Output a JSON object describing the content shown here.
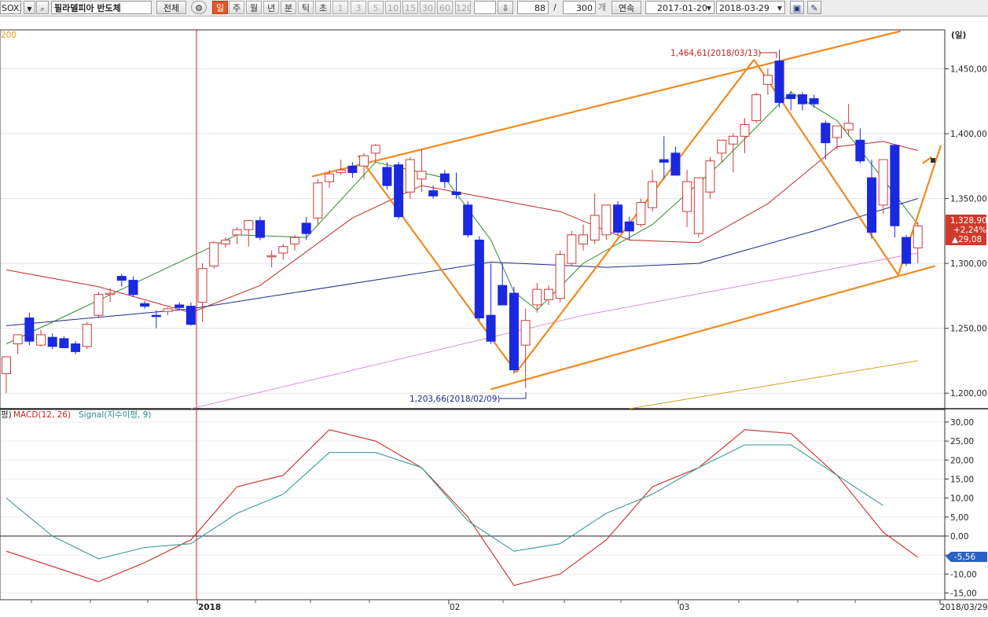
{
  "toolbar": {
    "symbol_code": "SOXX",
    "symbol_name": "필라델피아 반도체",
    "all_button": "전체",
    "periods": [
      {
        "label": "일",
        "active": true,
        "dim": false
      },
      {
        "label": "주",
        "active": false,
        "dim": false
      },
      {
        "label": "월",
        "active": false,
        "dim": false
      },
      {
        "label": "년",
        "active": false,
        "dim": false
      },
      {
        "label": "분",
        "active": false,
        "dim": false
      },
      {
        "label": "틱",
        "active": false,
        "dim": false
      },
      {
        "label": "초",
        "active": false,
        "dim": false
      },
      {
        "label": "1",
        "active": false,
        "dim": true
      },
      {
        "label": "3",
        "active": false,
        "dim": true
      },
      {
        "label": "5",
        "active": false,
        "dim": true
      },
      {
        "label": "10",
        "active": false,
        "dim": true
      },
      {
        "label": "15",
        "active": false,
        "dim": true
      },
      {
        "label": "30",
        "active": false,
        "dim": true
      },
      {
        "label": "60",
        "active": false,
        "dim": true
      },
      {
        "label": "120",
        "active": false,
        "dim": true
      }
    ],
    "count_value": "88",
    "separator": "/",
    "total_value": "300",
    "count_unit": "개",
    "continuous_button": "연속",
    "start_date": "2017-01-20",
    "end_date": "2018-03-29"
  },
  "header": {
    "period_unit": "(일)",
    "ma_label": "200"
  },
  "macd_header": {
    "prefix": "평)",
    "macd_label": "MACD(12, 26)",
    "signal_label": "Signal(지수이평, 9)"
  },
  "colors": {
    "up": "#d03a3a",
    "down": "#1a28e0",
    "ma5": "#2e8b2e",
    "ma20": "#c0282a",
    "ma60": "#1e2a8a",
    "ma120": "#d890d8",
    "ma200": "#d4a020",
    "trend": "#f08a20",
    "macd": "#d02828",
    "signal": "#3a9a9a",
    "cursor": "#cc2020"
  },
  "chart_data": [
    {
      "type": "candlestick",
      "title": "필라델피아 반도체",
      "x_labels": [
        "2018",
        "02",
        "03",
        "2018/03/29"
      ],
      "ylim": [
        1188,
        1480
      ],
      "y_ticks": [
        "1,200,00",
        "1,250,00",
        "1,300,00",
        "1,350,00",
        "1,400,00",
        "1,450,00"
      ],
      "candles": [
        {
          "o": 1215,
          "h": 1225,
          "l": 1200,
          "c": 1228
        },
        {
          "o": 1238,
          "h": 1245,
          "l": 1230,
          "c": 1245
        },
        {
          "o": 1258,
          "h": 1262,
          "l": 1237,
          "c": 1240
        },
        {
          "o": 1237,
          "h": 1249,
          "l": 1236,
          "c": 1245
        },
        {
          "o": 1243,
          "h": 1246,
          "l": 1234,
          "c": 1236
        },
        {
          "o": 1242,
          "h": 1244,
          "l": 1235,
          "c": 1235
        },
        {
          "o": 1238,
          "h": 1240,
          "l": 1230,
          "c": 1232
        },
        {
          "o": 1236,
          "h": 1255,
          "l": 1234,
          "c": 1253
        },
        {
          "o": 1260,
          "h": 1278,
          "l": 1258,
          "c": 1276
        },
        {
          "o": 1276,
          "h": 1281,
          "l": 1270,
          "c": 1277
        },
        {
          "o": 1290,
          "h": 1292,
          "l": 1282,
          "c": 1287
        },
        {
          "o": 1287,
          "h": 1290,
          "l": 1274,
          "c": 1276
        },
        {
          "o": 1269,
          "h": 1271,
          "l": 1265,
          "c": 1267
        },
        {
          "o": 1260,
          "h": 1264,
          "l": 1250,
          "c": 1259
        },
        {
          "o": 1263,
          "h": 1266,
          "l": 1260,
          "c": 1265
        },
        {
          "o": 1268,
          "h": 1270,
          "l": 1264,
          "c": 1266
        },
        {
          "o": 1267,
          "h": 1270,
          "l": 1252,
          "c": 1253
        },
        {
          "o": 1270,
          "h": 1300,
          "l": 1255,
          "c": 1296
        },
        {
          "o": 1298,
          "h": 1317,
          "l": 1296,
          "c": 1316
        },
        {
          "o": 1315,
          "h": 1320,
          "l": 1312,
          "c": 1318
        },
        {
          "o": 1322,
          "h": 1328,
          "l": 1315,
          "c": 1326
        },
        {
          "o": 1326,
          "h": 1330,
          "l": 1313,
          "c": 1333
        },
        {
          "o": 1333,
          "h": 1336,
          "l": 1318,
          "c": 1320
        },
        {
          "o": 1306,
          "h": 1310,
          "l": 1297,
          "c": 1306
        },
        {
          "o": 1308,
          "h": 1315,
          "l": 1303,
          "c": 1313
        },
        {
          "o": 1315,
          "h": 1322,
          "l": 1310,
          "c": 1320
        },
        {
          "o": 1331,
          "h": 1336,
          "l": 1318,
          "c": 1323
        },
        {
          "o": 1335,
          "h": 1365,
          "l": 1330,
          "c": 1362
        },
        {
          "o": 1363,
          "h": 1372,
          "l": 1358,
          "c": 1369
        },
        {
          "o": 1370,
          "h": 1380,
          "l": 1368,
          "c": 1372
        },
        {
          "o": 1375,
          "h": 1378,
          "l": 1366,
          "c": 1370
        },
        {
          "o": 1375,
          "h": 1385,
          "l": 1365,
          "c": 1383
        },
        {
          "o": 1385,
          "h": 1392,
          "l": 1378,
          "c": 1391
        },
        {
          "o": 1374,
          "h": 1378,
          "l": 1357,
          "c": 1360
        },
        {
          "o": 1376,
          "h": 1378,
          "l": 1334,
          "c": 1336
        },
        {
          "o": 1355,
          "h": 1382,
          "l": 1350,
          "c": 1380
        },
        {
          "o": 1365,
          "h": 1388,
          "l": 1355,
          "c": 1371
        },
        {
          "o": 1356,
          "h": 1360,
          "l": 1350,
          "c": 1352
        },
        {
          "o": 1369,
          "h": 1372,
          "l": 1358,
          "c": 1363
        },
        {
          "o": 1355,
          "h": 1370,
          "l": 1350,
          "c": 1353
        },
        {
          "o": 1345,
          "h": 1348,
          "l": 1320,
          "c": 1322
        },
        {
          "o": 1318,
          "h": 1321,
          "l": 1256,
          "c": 1258
        },
        {
          "o": 1260,
          "h": 1300,
          "l": 1238,
          "c": 1240
        },
        {
          "o": 1283,
          "h": 1300,
          "l": 1270,
          "c": 1268
        },
        {
          "o": 1277,
          "h": 1282,
          "l": 1215,
          "c": 1218
        },
        {
          "o": 1237,
          "h": 1265,
          "l": 1204,
          "c": 1256
        },
        {
          "o": 1268,
          "h": 1285,
          "l": 1262,
          "c": 1280
        },
        {
          "o": 1272,
          "h": 1283,
          "l": 1268,
          "c": 1280
        },
        {
          "o": 1273,
          "h": 1310,
          "l": 1270,
          "c": 1307
        },
        {
          "o": 1300,
          "h": 1325,
          "l": 1298,
          "c": 1322
        },
        {
          "o": 1315,
          "h": 1330,
          "l": 1310,
          "c": 1322
        },
        {
          "o": 1318,
          "h": 1354,
          "l": 1315,
          "c": 1337
        },
        {
          "o": 1322,
          "h": 1345,
          "l": 1318,
          "c": 1345
        },
        {
          "o": 1345,
          "h": 1348,
          "l": 1322,
          "c": 1324
        },
        {
          "o": 1332,
          "h": 1336,
          "l": 1318,
          "c": 1325
        },
        {
          "o": 1330,
          "h": 1350,
          "l": 1328,
          "c": 1347
        },
        {
          "o": 1343,
          "h": 1372,
          "l": 1340,
          "c": 1363
        },
        {
          "o": 1380,
          "h": 1398,
          "l": 1365,
          "c": 1378
        },
        {
          "o": 1385,
          "h": 1390,
          "l": 1368,
          "c": 1368
        },
        {
          "o": 1340,
          "h": 1372,
          "l": 1328,
          "c": 1363
        },
        {
          "o": 1323,
          "h": 1355,
          "l": 1320,
          "c": 1366
        },
        {
          "o": 1355,
          "h": 1382,
          "l": 1350,
          "c": 1379
        },
        {
          "o": 1385,
          "h": 1393,
          "l": 1378,
          "c": 1395
        },
        {
          "o": 1392,
          "h": 1400,
          "l": 1370,
          "c": 1398
        },
        {
          "o": 1398,
          "h": 1412,
          "l": 1385,
          "c": 1407
        },
        {
          "o": 1410,
          "h": 1432,
          "l": 1408,
          "c": 1430
        },
        {
          "o": 1438,
          "h": 1450,
          "l": 1430,
          "c": 1445
        },
        {
          "o": 1456,
          "h": 1464.61,
          "l": 1420,
          "c": 1424
        },
        {
          "o": 1430,
          "h": 1433,
          "l": 1418,
          "c": 1427
        },
        {
          "o": 1430,
          "h": 1432,
          "l": 1418,
          "c": 1423
        },
        {
          "o": 1427,
          "h": 1430,
          "l": 1420,
          "c": 1423
        },
        {
          "o": 1408,
          "h": 1410,
          "l": 1380,
          "c": 1393
        },
        {
          "o": 1397,
          "h": 1405,
          "l": 1388,
          "c": 1406
        },
        {
          "o": 1403,
          "h": 1423,
          "l": 1398,
          "c": 1408
        },
        {
          "o": 1395,
          "h": 1404,
          "l": 1377,
          "c": 1379
        },
        {
          "o": 1366,
          "h": 1380,
          "l": 1319,
          "c": 1324
        },
        {
          "o": 1345,
          "h": 1380,
          "l": 1338,
          "c": 1380
        },
        {
          "o": 1391,
          "h": 1392,
          "l": 1320,
          "c": 1329
        },
        {
          "o": 1320,
          "h": 1322,
          "l": 1298,
          "c": 1300
        },
        {
          "o": 1312,
          "h": 1332,
          "l": 1300,
          "c": 1328.9
        }
      ],
      "moving_averages": [
        {
          "name": "MA5",
          "points": [
            [
              0,
              1238
            ],
            [
              10,
              1280
            ],
            [
              20,
              1322
            ],
            [
              26,
              1320
            ],
            [
              32,
              1378
            ],
            [
              38,
              1366
            ],
            [
              42,
              1318
            ],
            [
              44,
              1278
            ],
            [
              46,
              1264
            ],
            [
              50,
              1300
            ],
            [
              56,
              1330
            ],
            [
              62,
              1378
            ],
            [
              68,
              1432
            ],
            [
              72,
              1410
            ],
            [
              76,
              1365
            ],
            [
              79,
              1330
            ]
          ]
        },
        {
          "name": "MA20",
          "points": [
            [
              0,
              1295
            ],
            [
              8,
              1282
            ],
            [
              16,
              1262
            ],
            [
              22,
              1283
            ],
            [
              30,
              1335
            ],
            [
              36,
              1360
            ],
            [
              42,
              1350
            ],
            [
              48,
              1340
            ],
            [
              54,
              1318
            ],
            [
              60,
              1316
            ],
            [
              66,
              1346
            ],
            [
              72,
              1390
            ],
            [
              76,
              1394
            ],
            [
              79,
              1387
            ]
          ]
        },
        {
          "name": "MA60",
          "points": [
            [
              0,
              1252
            ],
            [
              16,
              1265
            ],
            [
              34,
              1290
            ],
            [
              42,
              1301
            ],
            [
              52,
              1297
            ],
            [
              60,
              1300
            ],
            [
              70,
              1325
            ],
            [
              79,
              1350
            ]
          ]
        },
        {
          "name": "MA120",
          "points": [
            [
              16,
              1188
            ],
            [
              50,
              1260
            ],
            [
              79,
              1308
            ]
          ]
        },
        {
          "name": "MA200",
          "points": [
            [
              54,
              1188
            ],
            [
              79,
              1225
            ]
          ]
        }
      ],
      "annotations": [
        {
          "text": "1,464,61(2018/03/13)",
          "value": 1464.61
        },
        {
          "text": "1,203,66(2018/02/09)",
          "value": 1203.66
        }
      ],
      "last_price": {
        "value": "1,328,90",
        "change_pct": "+2,24%",
        "change": "▲29,08"
      }
    },
    {
      "type": "line",
      "title": "MACD(12, 26) Signal(지수이평, 9)",
      "ylim": [
        -17,
        32
      ],
      "y_ticks": [
        "-15,00",
        "-10,00",
        "-5,00",
        "0,00",
        "5,00",
        "10,00",
        "15,00",
        "20,00",
        "25,00",
        "30,00"
      ],
      "last_value": "-5,56",
      "series": [
        {
          "name": "MACD(12, 26)",
          "points": [
            [
              0,
              -4
            ],
            [
              4,
              -8
            ],
            [
              8,
              -12
            ],
            [
              12,
              -7
            ],
            [
              16,
              -1
            ],
            [
              20,
              13
            ],
            [
              24,
              16
            ],
            [
              28,
              28
            ],
            [
              32,
              25
            ],
            [
              36,
              18
            ],
            [
              40,
              5
            ],
            [
              44,
              -13
            ],
            [
              48,
              -10
            ],
            [
              52,
              -1
            ],
            [
              56,
              13
            ],
            [
              60,
              18
            ],
            [
              64,
              28
            ],
            [
              68,
              27
            ],
            [
              72,
              16
            ],
            [
              76,
              1
            ],
            [
              79,
              -5.56
            ]
          ]
        },
        {
          "name": "Signal(지수이평, 9)",
          "points": [
            [
              0,
              10
            ],
            [
              4,
              0
            ],
            [
              8,
              -6
            ],
            [
              12,
              -3
            ],
            [
              16,
              -2
            ],
            [
              20,
              6
            ],
            [
              24,
              11
            ],
            [
              28,
              22
            ],
            [
              32,
              22
            ],
            [
              36,
              18
            ],
            [
              40,
              4
            ],
            [
              44,
              -4
            ],
            [
              48,
              -2
            ],
            [
              52,
              6
            ],
            [
              56,
              11
            ],
            [
              60,
              18
            ],
            [
              64,
              24
            ],
            [
              68,
              24
            ],
            [
              72,
              16
            ],
            [
              76,
              8
            ]
          ]
        }
      ]
    }
  ]
}
